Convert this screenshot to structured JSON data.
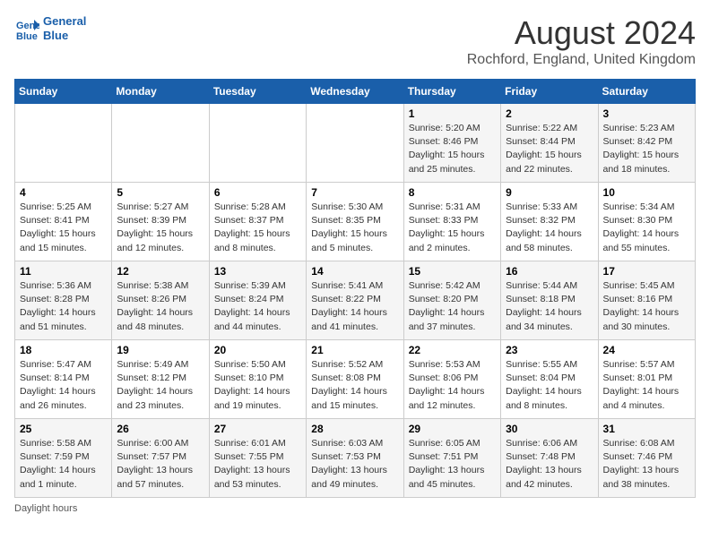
{
  "header": {
    "logo_line1": "General",
    "logo_line2": "Blue",
    "month_year": "August 2024",
    "location": "Rochford, England, United Kingdom"
  },
  "weekdays": [
    "Sunday",
    "Monday",
    "Tuesday",
    "Wednesday",
    "Thursday",
    "Friday",
    "Saturday"
  ],
  "weeks": [
    [
      {
        "day": "",
        "info": ""
      },
      {
        "day": "",
        "info": ""
      },
      {
        "day": "",
        "info": ""
      },
      {
        "day": "",
        "info": ""
      },
      {
        "day": "1",
        "info": "Sunrise: 5:20 AM\nSunset: 8:46 PM\nDaylight: 15 hours\nand 25 minutes."
      },
      {
        "day": "2",
        "info": "Sunrise: 5:22 AM\nSunset: 8:44 PM\nDaylight: 15 hours\nand 22 minutes."
      },
      {
        "day": "3",
        "info": "Sunrise: 5:23 AM\nSunset: 8:42 PM\nDaylight: 15 hours\nand 18 minutes."
      }
    ],
    [
      {
        "day": "4",
        "info": "Sunrise: 5:25 AM\nSunset: 8:41 PM\nDaylight: 15 hours\nand 15 minutes."
      },
      {
        "day": "5",
        "info": "Sunrise: 5:27 AM\nSunset: 8:39 PM\nDaylight: 15 hours\nand 12 minutes."
      },
      {
        "day": "6",
        "info": "Sunrise: 5:28 AM\nSunset: 8:37 PM\nDaylight: 15 hours\nand 8 minutes."
      },
      {
        "day": "7",
        "info": "Sunrise: 5:30 AM\nSunset: 8:35 PM\nDaylight: 15 hours\nand 5 minutes."
      },
      {
        "day": "8",
        "info": "Sunrise: 5:31 AM\nSunset: 8:33 PM\nDaylight: 15 hours\nand 2 minutes."
      },
      {
        "day": "9",
        "info": "Sunrise: 5:33 AM\nSunset: 8:32 PM\nDaylight: 14 hours\nand 58 minutes."
      },
      {
        "day": "10",
        "info": "Sunrise: 5:34 AM\nSunset: 8:30 PM\nDaylight: 14 hours\nand 55 minutes."
      }
    ],
    [
      {
        "day": "11",
        "info": "Sunrise: 5:36 AM\nSunset: 8:28 PM\nDaylight: 14 hours\nand 51 minutes."
      },
      {
        "day": "12",
        "info": "Sunrise: 5:38 AM\nSunset: 8:26 PM\nDaylight: 14 hours\nand 48 minutes."
      },
      {
        "day": "13",
        "info": "Sunrise: 5:39 AM\nSunset: 8:24 PM\nDaylight: 14 hours\nand 44 minutes."
      },
      {
        "day": "14",
        "info": "Sunrise: 5:41 AM\nSunset: 8:22 PM\nDaylight: 14 hours\nand 41 minutes."
      },
      {
        "day": "15",
        "info": "Sunrise: 5:42 AM\nSunset: 8:20 PM\nDaylight: 14 hours\nand 37 minutes."
      },
      {
        "day": "16",
        "info": "Sunrise: 5:44 AM\nSunset: 8:18 PM\nDaylight: 14 hours\nand 34 minutes."
      },
      {
        "day": "17",
        "info": "Sunrise: 5:45 AM\nSunset: 8:16 PM\nDaylight: 14 hours\nand 30 minutes."
      }
    ],
    [
      {
        "day": "18",
        "info": "Sunrise: 5:47 AM\nSunset: 8:14 PM\nDaylight: 14 hours\nand 26 minutes."
      },
      {
        "day": "19",
        "info": "Sunrise: 5:49 AM\nSunset: 8:12 PM\nDaylight: 14 hours\nand 23 minutes."
      },
      {
        "day": "20",
        "info": "Sunrise: 5:50 AM\nSunset: 8:10 PM\nDaylight: 14 hours\nand 19 minutes."
      },
      {
        "day": "21",
        "info": "Sunrise: 5:52 AM\nSunset: 8:08 PM\nDaylight: 14 hours\nand 15 minutes."
      },
      {
        "day": "22",
        "info": "Sunrise: 5:53 AM\nSunset: 8:06 PM\nDaylight: 14 hours\nand 12 minutes."
      },
      {
        "day": "23",
        "info": "Sunrise: 5:55 AM\nSunset: 8:04 PM\nDaylight: 14 hours\nand 8 minutes."
      },
      {
        "day": "24",
        "info": "Sunrise: 5:57 AM\nSunset: 8:01 PM\nDaylight: 14 hours\nand 4 minutes."
      }
    ],
    [
      {
        "day": "25",
        "info": "Sunrise: 5:58 AM\nSunset: 7:59 PM\nDaylight: 14 hours\nand 1 minute."
      },
      {
        "day": "26",
        "info": "Sunrise: 6:00 AM\nSunset: 7:57 PM\nDaylight: 13 hours\nand 57 minutes."
      },
      {
        "day": "27",
        "info": "Sunrise: 6:01 AM\nSunset: 7:55 PM\nDaylight: 13 hours\nand 53 minutes."
      },
      {
        "day": "28",
        "info": "Sunrise: 6:03 AM\nSunset: 7:53 PM\nDaylight: 13 hours\nand 49 minutes."
      },
      {
        "day": "29",
        "info": "Sunrise: 6:05 AM\nSunset: 7:51 PM\nDaylight: 13 hours\nand 45 minutes."
      },
      {
        "day": "30",
        "info": "Sunrise: 6:06 AM\nSunset: 7:48 PM\nDaylight: 13 hours\nand 42 minutes."
      },
      {
        "day": "31",
        "info": "Sunrise: 6:08 AM\nSunset: 7:46 PM\nDaylight: 13 hours\nand 38 minutes."
      }
    ]
  ],
  "footer": "Daylight hours"
}
